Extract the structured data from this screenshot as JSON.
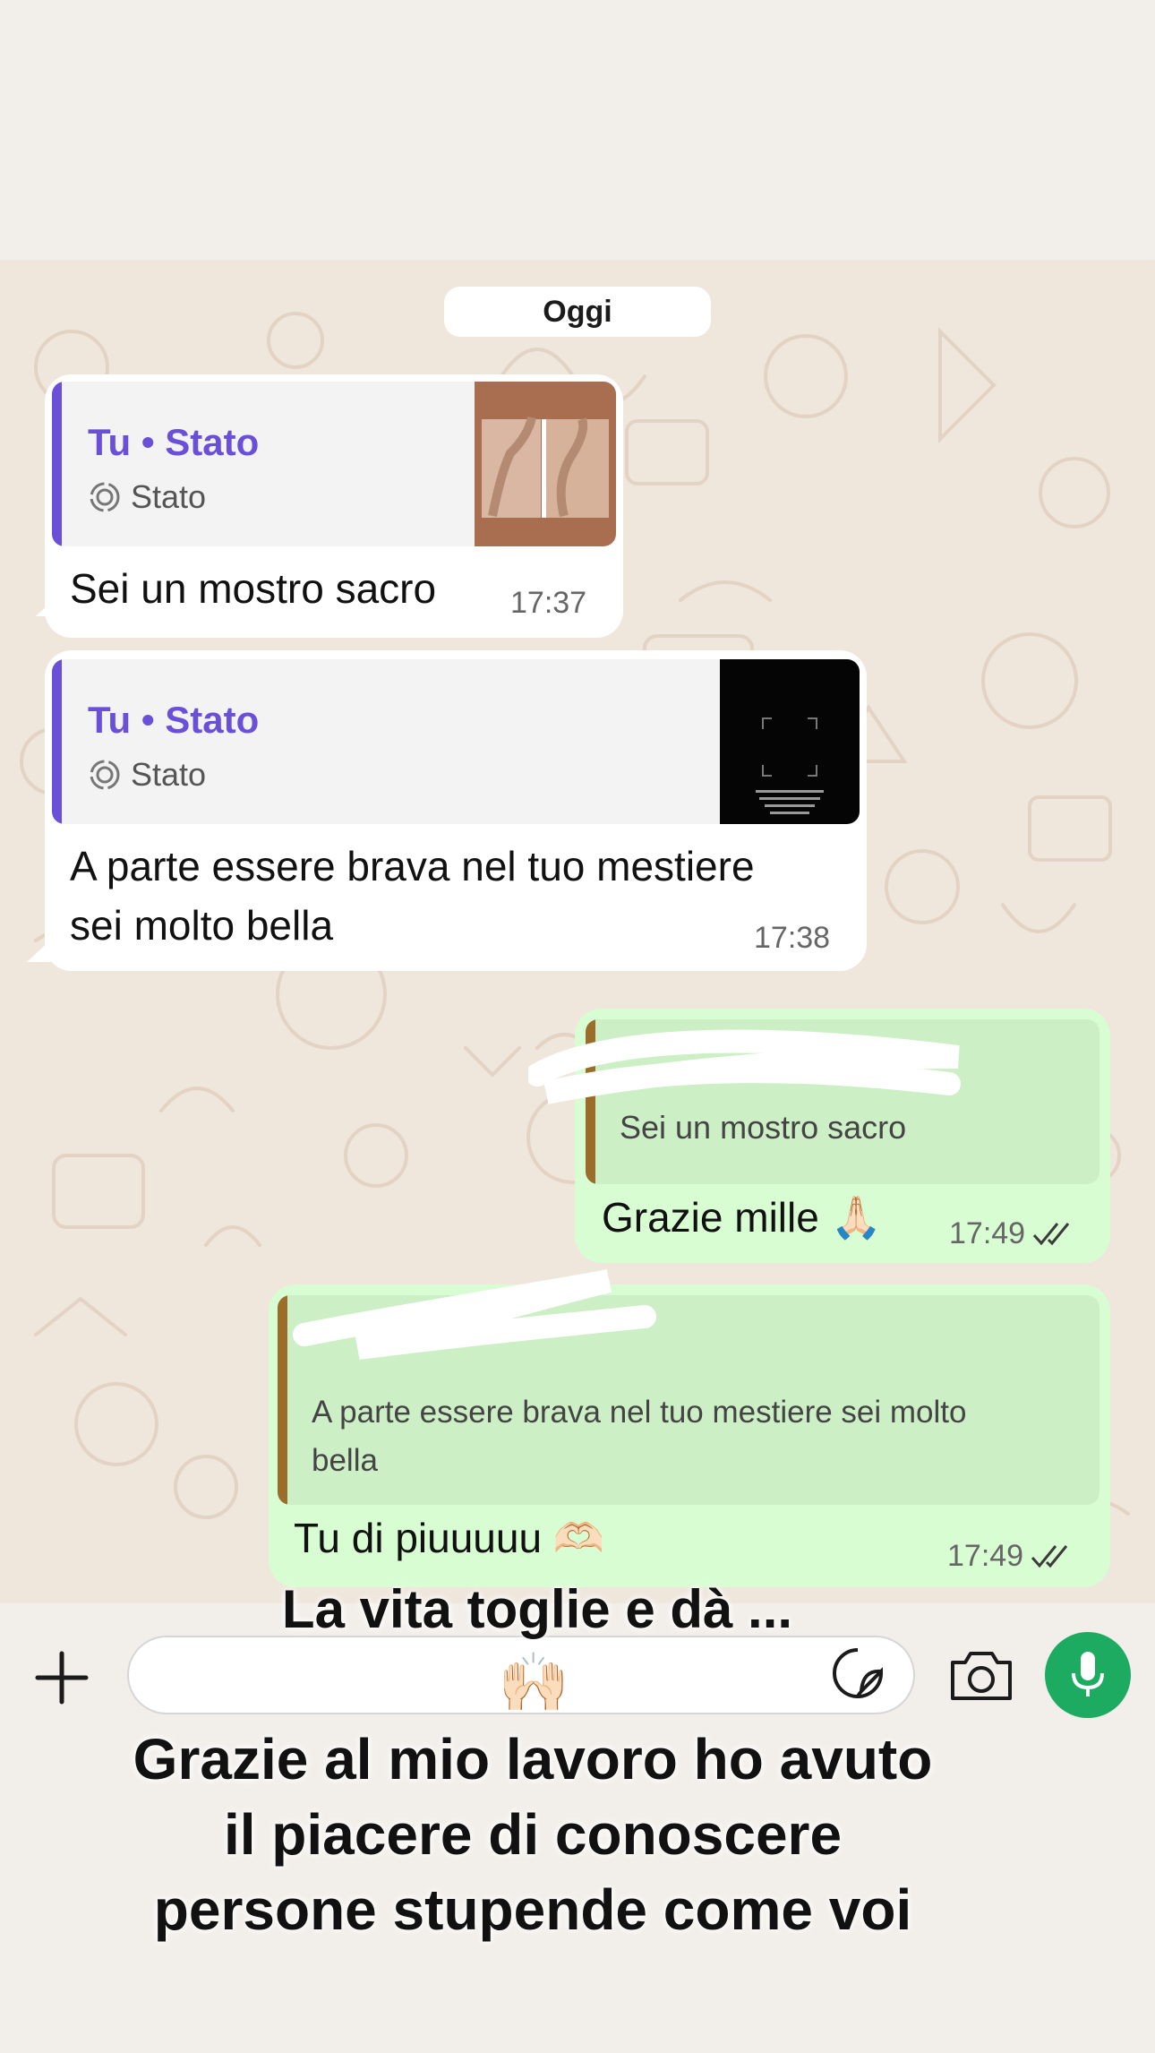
{
  "chat": {
    "day_separator": "Oggi",
    "messages": [
      {
        "direction": "incoming",
        "reply": {
          "author": "Tu • Stato",
          "type": "Stato"
        },
        "text": "Sei un mostro sacro",
        "time": "17:37"
      },
      {
        "direction": "incoming",
        "reply": {
          "author": "Tu • Stato",
          "type": "Stato"
        },
        "text_line1": "A parte essere brava nel tuo mestiere",
        "text_line2": "sei molto bella",
        "time": "17:38"
      },
      {
        "direction": "outgoing",
        "reply": {
          "author_hidden": true,
          "text": "Sei un mostro sacro"
        },
        "text": "Grazie mille 🙏🏻",
        "time": "17:49",
        "status": "read"
      },
      {
        "direction": "outgoing",
        "reply": {
          "author_hidden": true,
          "text_line1": "A parte essere brava nel tuo mestiere sei molto",
          "text_line2": "bella"
        },
        "text": "Tu di piuuuuu 🫶🏻",
        "time": "17:49",
        "status": "read"
      }
    ]
  },
  "input": {
    "icons": [
      "plus-icon",
      "sticker-icon",
      "camera-icon",
      "mic-icon"
    ]
  },
  "overlay": {
    "caption_top": "La vita toglie e dà ...",
    "emoji": "🙌🏻",
    "caption_line1": "Grazie al mio lavoro ho avuto",
    "caption_line2": "il piacere di conoscere",
    "caption_line3": "persone stupende come voi"
  },
  "colors": {
    "accent_purple": "#6a4fd8",
    "outgoing_bubble": "#d9fdd3",
    "mic_green": "#1daa61",
    "read_ticks": "#3b3b3b"
  }
}
